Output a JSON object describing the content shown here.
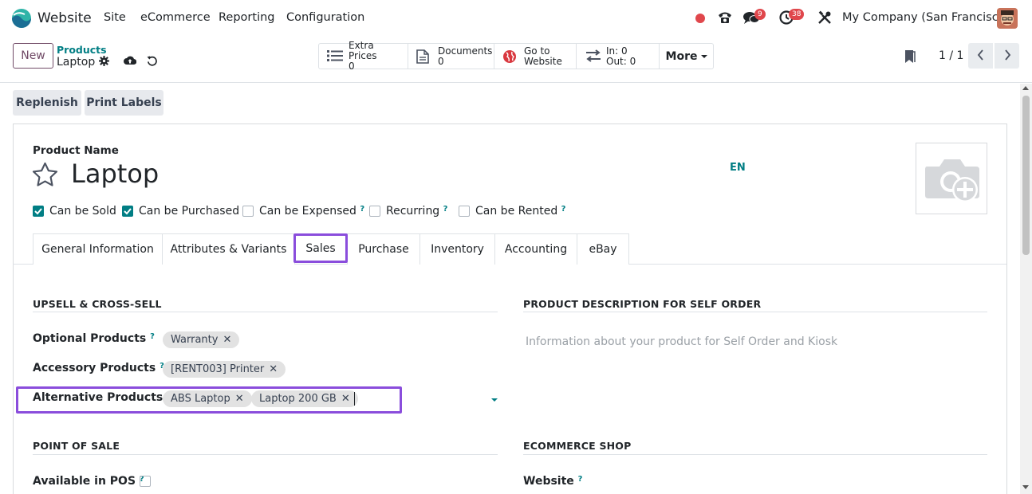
{
  "topbar": {
    "app_name": "Website",
    "menu": [
      "Site",
      "eCommerce",
      "Reporting",
      "Configuration"
    ],
    "messages_count": "9",
    "activities_count": "38",
    "company": "My Company (San Francisco)"
  },
  "control": {
    "new_label": "New",
    "breadcrumb_parent": "Products",
    "breadcrumb_current": "Laptop",
    "smart_buttons": [
      {
        "l1": "Extra Prices",
        "l2": "0",
        "icon": "list-icon"
      },
      {
        "l1": "Documents",
        "l2": "0",
        "icon": "document-icon"
      },
      {
        "l1": "Go to",
        "l2": "Website",
        "icon": "globe-icon"
      },
      {
        "l1": "In: 0",
        "l2": "Out: 0",
        "icon": "transfer-icon"
      }
    ],
    "more_label": "More",
    "pager": "1 / 1"
  },
  "actions": {
    "replenish": "Replenish",
    "print_labels": "Print Labels"
  },
  "form": {
    "product_name_label": "Product Name",
    "product_name": "Laptop",
    "lang": "EN",
    "checkboxes": [
      {
        "label": "Can be Sold",
        "checked": true,
        "help": false
      },
      {
        "label": "Can be Purchased",
        "checked": true,
        "help": false
      },
      {
        "label": "Can be Expensed",
        "checked": false,
        "help": true
      },
      {
        "label": "Recurring",
        "checked": false,
        "help": true
      },
      {
        "label": "Can be Rented",
        "checked": false,
        "help": true
      }
    ],
    "help_mark": "?",
    "tabs": [
      "General Information",
      "Attributes & Variants",
      "Sales",
      "Purchase",
      "Inventory",
      "Accounting",
      "eBay"
    ],
    "active_tab": "Sales"
  },
  "sales": {
    "upsell_title": "UPSELL & CROSS-SELL",
    "optional_label": "Optional Products",
    "optional_tags": [
      "Warranty"
    ],
    "accessory_label": "Accessory Products",
    "accessory_tags": [
      "[RENT003] Printer"
    ],
    "alternative_label": "Alternative Products",
    "alternative_tags": [
      "ABS Laptop",
      "Laptop 200 GB"
    ],
    "self_order_title": "PRODUCT DESCRIPTION FOR SELF ORDER",
    "self_order_placeholder": "Information about your product for Self Order and Kiosk",
    "pos_title": "POINT OF SALE",
    "pos_available_label": "Available in POS",
    "ecommerce_title": "ECOMMERCE SHOP",
    "website_label": "Website"
  },
  "colors": {
    "accent": "#714b67",
    "teal": "#017e84",
    "highlight": "#8a4ddc",
    "badge": "#e0474c"
  }
}
